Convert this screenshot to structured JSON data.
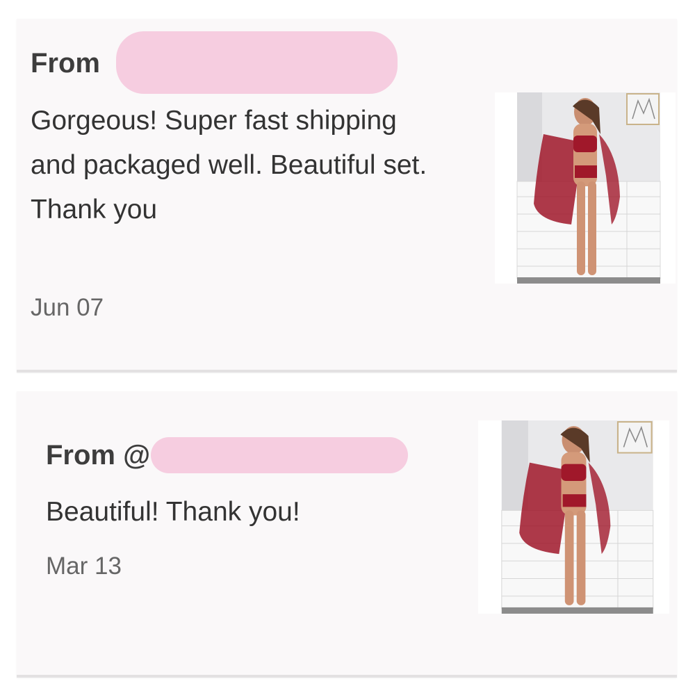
{
  "reviews": [
    {
      "from_label": "From",
      "text": "Gorgeous! Super fast shipping and packaged well. Beautiful set. Thank you",
      "date": "Jun 07",
      "thumbnail_icon": "product-photo-red-lingerie"
    },
    {
      "from_label": "From @",
      "text": "Beautiful! Thank you!",
      "date": "Mar 13",
      "thumbnail_icon": "product-photo-red-lingerie"
    }
  ],
  "colors": {
    "card_bg": "#faf8f9",
    "redaction": "#f6cde0",
    "garment": "#a0182a"
  }
}
